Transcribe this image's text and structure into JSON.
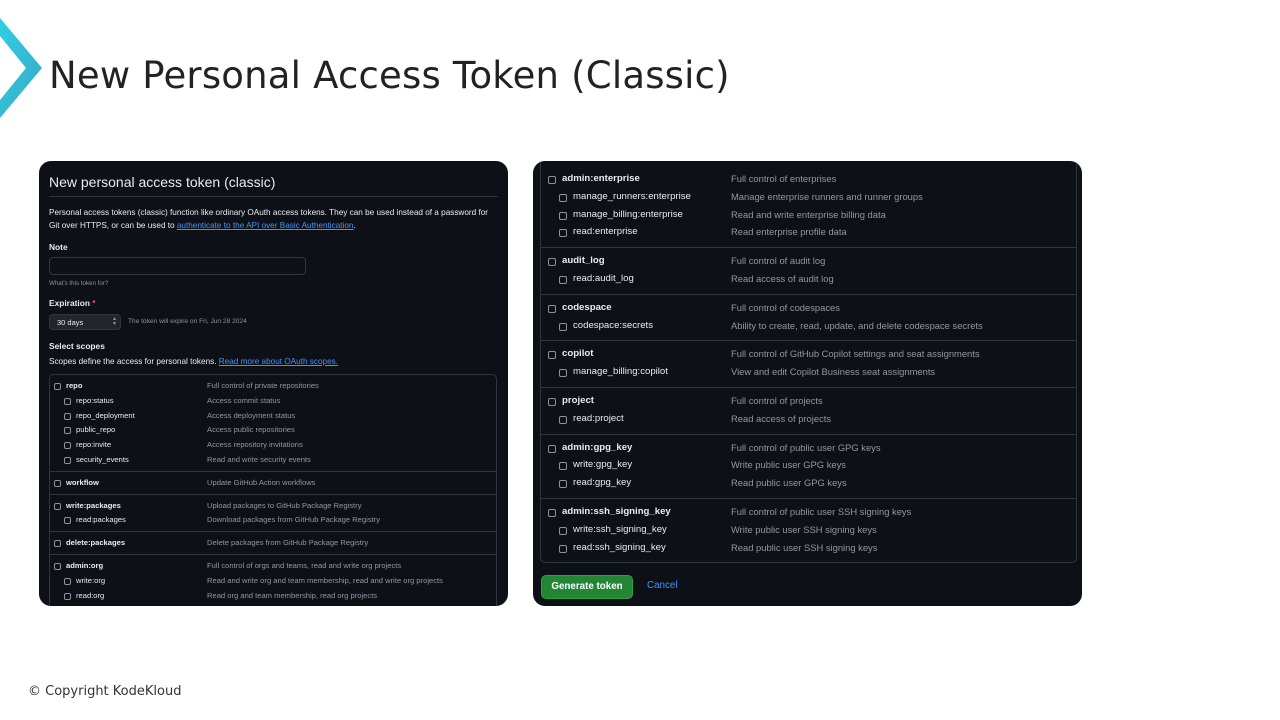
{
  "slide": {
    "title": "New Personal Access Token (Classic)",
    "copyright": "© Copyright KodeKloud",
    "accent_color": "#36c5d6"
  },
  "left_panel": {
    "heading": "New personal access token (classic)",
    "intro": "Personal access tokens (classic) function like ordinary OAuth access tokens. They can be used instead of a password for Git over HTTPS, or can be used to ",
    "intro_link": "authenticate to the API over Basic Authentication",
    "intro_end": ".",
    "note_label": "Note",
    "note_value": "",
    "note_hint": "What's this token for?",
    "expiration_label": "Expiration",
    "expiration_required": "*",
    "expiration_value": "30 days",
    "expiration_note": "The token will expire on Fri, Jun 28 2024",
    "select_scopes_label": "Select scopes",
    "scopes_desc": "Scopes define the access for personal tokens. ",
    "scopes_link": "Read more about OAuth scopes.",
    "scopes": [
      {
        "name": "repo",
        "desc": "Full control of private repositories",
        "children": [
          {
            "name": "repo:status",
            "desc": "Access commit status"
          },
          {
            "name": "repo_deployment",
            "desc": "Access deployment status"
          },
          {
            "name": "public_repo",
            "desc": "Access public repositories"
          },
          {
            "name": "repo:invite",
            "desc": "Access repository invitations"
          },
          {
            "name": "security_events",
            "desc": "Read and write security events"
          }
        ]
      },
      {
        "name": "workflow",
        "desc": "Update GitHub Action workflows",
        "children": []
      },
      {
        "name": "write:packages",
        "desc": "Upload packages to GitHub Package Registry",
        "children": [
          {
            "name": "read:packages",
            "desc": "Download packages from GitHub Package Registry"
          }
        ]
      },
      {
        "name": "delete:packages",
        "desc": "Delete packages from GitHub Package Registry",
        "children": []
      },
      {
        "name": "admin:org",
        "desc": "Full control of orgs and teams, read and write org projects",
        "children": [
          {
            "name": "write:org",
            "desc": "Read and write org and team membership, read and write org projects"
          },
          {
            "name": "read:org",
            "desc": "Read org and team membership, read org projects"
          }
        ]
      }
    ]
  },
  "right_panel": {
    "scopes": [
      {
        "name": "admin:enterprise",
        "desc": "Full control of enterprises",
        "children": [
          {
            "name": "manage_runners:enterprise",
            "desc": "Manage enterprise runners and runner groups"
          },
          {
            "name": "manage_billing:enterprise",
            "desc": "Read and write enterprise billing data"
          },
          {
            "name": "read:enterprise",
            "desc": "Read enterprise profile data"
          }
        ]
      },
      {
        "name": "audit_log",
        "desc": "Full control of audit log",
        "children": [
          {
            "name": "read:audit_log",
            "desc": "Read access of audit log"
          }
        ]
      },
      {
        "name": "codespace",
        "desc": "Full control of codespaces",
        "children": [
          {
            "name": "codespace:secrets",
            "desc": "Ability to create, read, update, and delete codespace secrets"
          }
        ]
      },
      {
        "name": "copilot",
        "desc": "Full control of GitHub Copilot settings and seat assignments",
        "children": [
          {
            "name": "manage_billing:copilot",
            "desc": "View and edit Copilot Business seat assignments"
          }
        ]
      },
      {
        "name": "project",
        "desc": "Full control of projects",
        "children": [
          {
            "name": "read:project",
            "desc": "Read access of projects"
          }
        ]
      },
      {
        "name": "admin:gpg_key",
        "desc": "Full control of public user GPG keys",
        "children": [
          {
            "name": "write:gpg_key",
            "desc": "Write public user GPG keys"
          },
          {
            "name": "read:gpg_key",
            "desc": "Read public user GPG keys"
          }
        ]
      },
      {
        "name": "admin:ssh_signing_key",
        "desc": "Full control of public user SSH signing keys",
        "children": [
          {
            "name": "write:ssh_signing_key",
            "desc": "Write public user SSH signing keys"
          },
          {
            "name": "read:ssh_signing_key",
            "desc": "Read public user SSH signing keys"
          }
        ]
      }
    ],
    "generate_button": "Generate token",
    "cancel_link": "Cancel"
  }
}
